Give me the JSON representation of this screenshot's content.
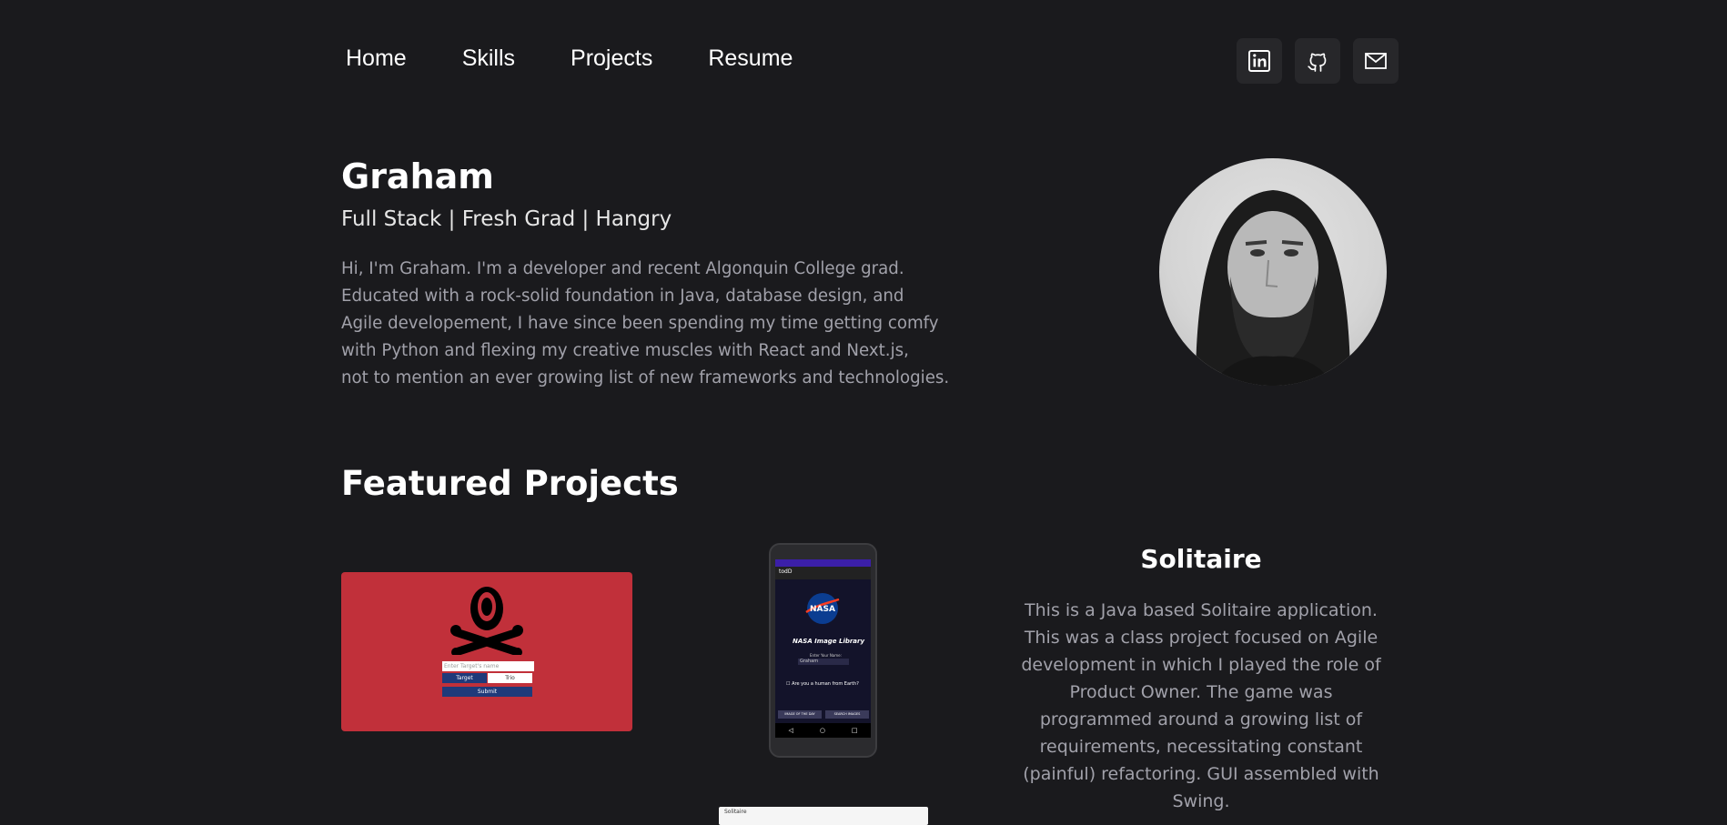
{
  "nav": {
    "items": [
      "Home",
      "Skills",
      "Projects",
      "Resume"
    ]
  },
  "socials": {
    "icons": [
      "linkedin-icon",
      "github-icon",
      "mail-icon"
    ]
  },
  "hero": {
    "name": "Graham",
    "tagline": "Full Stack | Fresh Grad | Hangry",
    "bio_lines": [
      "Hi, I'm Graham. I'm a developer and recent Algonquin College grad.",
      "Educated with a rock-solid foundation in Java, database design, and",
      "Agile developement, I have since been spending my time getting comfy",
      "with Python and flexing my creative muscles with React and Next.js,",
      "not to mention an ever growing list of new frameworks and technologies."
    ]
  },
  "featured": {
    "title": "Featured Projects",
    "project1_inputs": {
      "placeholder": "Enter Target's name",
      "target_label": "Target",
      "trio_label": "Trio",
      "submit_label": "Submit"
    },
    "phone_app": {
      "title": "NASA Image Library",
      "name_label": "Enter Your Name:",
      "name_value": "Graham",
      "checkbox_label": "Are you a human from Earth?",
      "button_left": "IMAGE OF THE DAY",
      "button_right": "SEARCH IMAGES",
      "app_name": "todD"
    },
    "solitaire_window_title": "Solitaire",
    "project": {
      "title": "Solitaire",
      "description": "This is a Java based Solitaire application. This was a class project focused on Agile development in which I played the role of Product Owner. The game was programmed around a growing list of requirements, necessitating constant (painful) refactoring. GUI assembled with Swing."
    }
  },
  "colors": {
    "background": "#1a1a1d",
    "social_button_bg": "#27272a",
    "muted_text": "#a1a1aa",
    "project_red": "#c1303a"
  }
}
